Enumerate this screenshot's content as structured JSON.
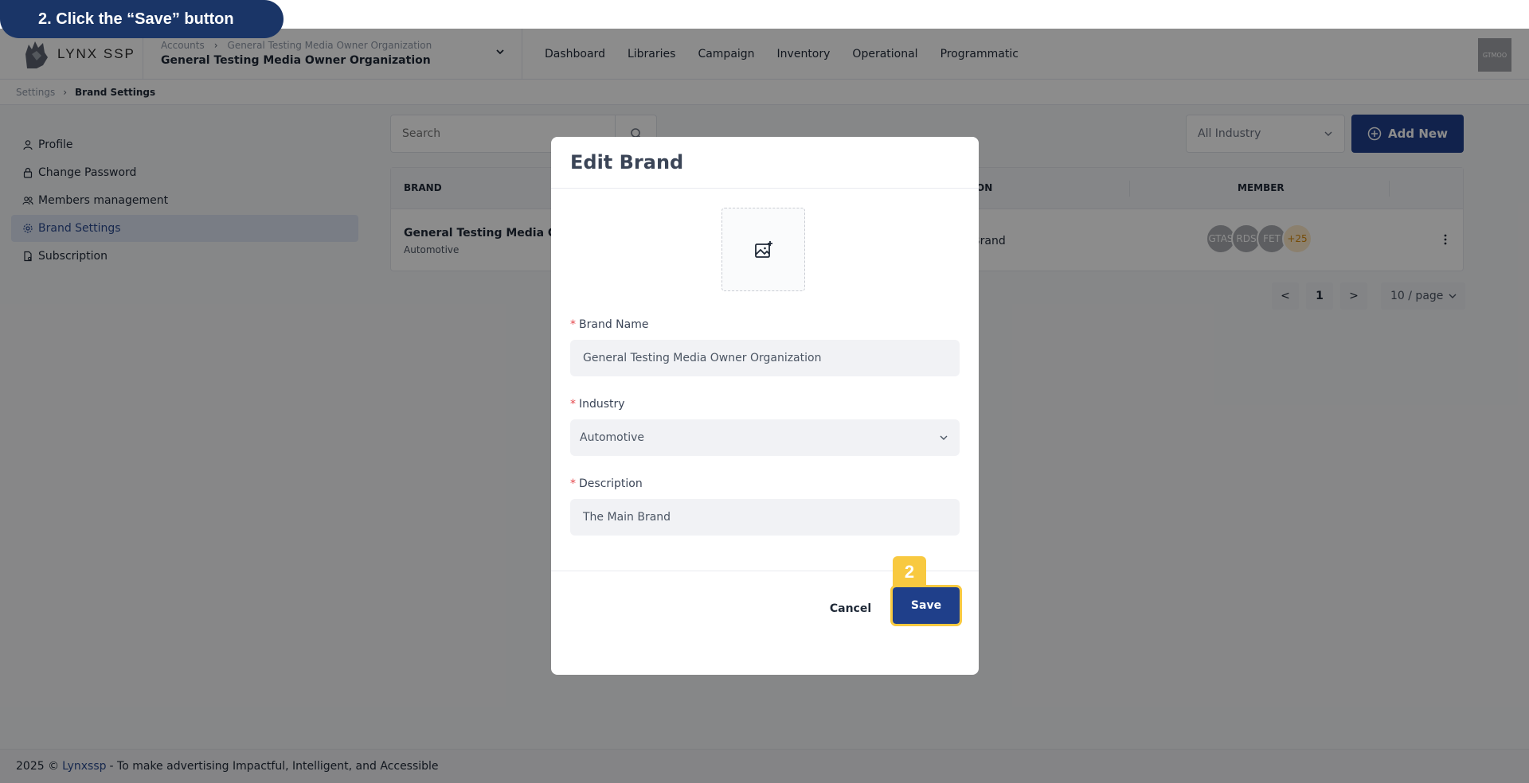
{
  "tutorial": {
    "step_text": "2. Click the “Save” button",
    "badge": "2"
  },
  "header": {
    "logo_text": "LYNX SSP",
    "breadcrumb": [
      "Accounts",
      "General Testing Media Owner Organization"
    ],
    "org_name": "General Testing Media Owner Organization",
    "nav": [
      "Dashboard",
      "Libraries",
      "Campaign",
      "Inventory",
      "Operational",
      "Programmatic"
    ],
    "avatar_text": "GTMOO"
  },
  "page_breadcrumb": {
    "parent": "Settings",
    "current": "Brand Settings"
  },
  "sidebar": {
    "items": [
      {
        "label": "Profile",
        "icon": "user-icon"
      },
      {
        "label": "Change Password",
        "icon": "lock-icon"
      },
      {
        "label": "Members management",
        "icon": "users-icon"
      },
      {
        "label": "Brand Settings",
        "icon": "gear-icon",
        "active": true
      },
      {
        "label": "Subscription",
        "icon": "file-icon"
      }
    ]
  },
  "toolbar": {
    "search_placeholder": "Search",
    "industry_filter": "All Industry",
    "add_new": "Add New"
  },
  "table": {
    "headers": [
      "BRAND",
      "ON",
      "MEMBER"
    ],
    "rows": [
      {
        "brand": "General Testing Media Ow",
        "industry": "Automotive",
        "description": "Brand",
        "members": [
          "GTAS",
          "RDS",
          "FET",
          "+25"
        ]
      }
    ]
  },
  "pagination": {
    "prev": "<",
    "page": "1",
    "next": ">",
    "page_size": "10 / page"
  },
  "modal": {
    "title": "Edit Brand",
    "fields": {
      "brand_name_label": "Brand Name",
      "brand_name_value": "General Testing Media Owner Organization",
      "industry_label": "Industry",
      "industry_value": "Automotive",
      "description_label": "Description",
      "description_value": "The Main Brand"
    },
    "cancel_label": "Cancel",
    "save_label": "Save"
  },
  "footer": {
    "prefix": "2025 ©",
    "brand": "Lynxssp",
    "suffix": "- To make advertising Impactful, Intelligent, and Accessible"
  },
  "colors": {
    "primary": "#1f3f8a",
    "highlight": "#f8c940",
    "pill": "#1a3567"
  }
}
